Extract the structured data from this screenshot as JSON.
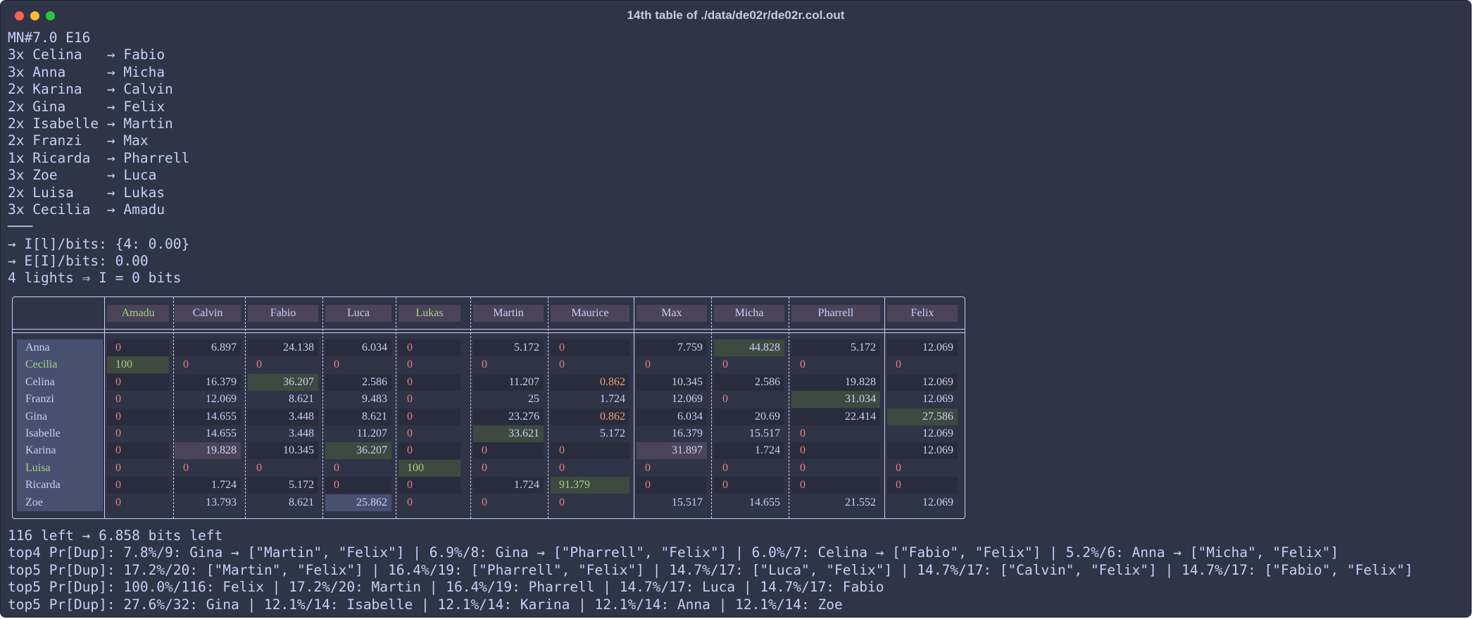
{
  "window": {
    "title": "14th table of ./data/de02r/de02r.col.out"
  },
  "header_lines": [
    "MN#7.0 E16",
    "3x Celina   → Fabio",
    "3x Anna     → Micha",
    "2x Karina   → Calvin",
    "2x Gina     → Felix",
    "2x Isabelle → Martin",
    "2x Franzi   → Max",
    "1x Ricarda  → Pharrell",
    "3x Zoe      → Luca",
    "2x Luisa    → Lukas",
    "3x Cecilia  → Amadu",
    "───",
    "→ I[l]/bits: {4: 0.00}",
    "→ E[I]/bits: 0.00",
    "4 lights ⇒ I = 0 bits"
  ],
  "table": {
    "columns": [
      "Amadu",
      "Calvin",
      "Fabio",
      "Luca",
      "Lukas",
      "Martin",
      "Maurice",
      "Max",
      "Micha",
      "Pharrell",
      "Felix"
    ],
    "rows": [
      {
        "name": "Anna",
        "cells": [
          "0",
          "6.897",
          "24.138",
          "6.034",
          "0",
          "5.172",
          "0",
          "7.759",
          "44.828",
          "5.172",
          "12.069"
        ]
      },
      {
        "name": "Cecilia",
        "cells": [
          "100",
          "0",
          "0",
          "0",
          "0",
          "0",
          "0",
          "0",
          "0",
          "0",
          "0"
        ]
      },
      {
        "name": "Celina",
        "cells": [
          "0",
          "16.379",
          "36.207",
          "2.586",
          "0",
          "11.207",
          "0.862",
          "10.345",
          "2.586",
          "19.828",
          "12.069"
        ]
      },
      {
        "name": "Franzi",
        "cells": [
          "0",
          "12.069",
          "8.621",
          "9.483",
          "0",
          "25",
          "1.724",
          "12.069",
          "0",
          "31.034",
          "12.069"
        ]
      },
      {
        "name": "Gina",
        "cells": [
          "0",
          "14.655",
          "3.448",
          "8.621",
          "0",
          "23.276",
          "0.862",
          "6.034",
          "20.69",
          "22.414",
          "27.586"
        ]
      },
      {
        "name": "Isabelle",
        "cells": [
          "0",
          "14.655",
          "3.448",
          "11.207",
          "0",
          "33.621",
          "5.172",
          "16.379",
          "15.517",
          "0",
          "12.069"
        ]
      },
      {
        "name": "Karina",
        "cells": [
          "0",
          "19.828",
          "10.345",
          "36.207",
          "0",
          "0",
          "0",
          "31.897",
          "1.724",
          "0",
          "12.069"
        ]
      },
      {
        "name": "Luisa",
        "cells": [
          "0",
          "0",
          "0",
          "0",
          "100",
          "0",
          "0",
          "0",
          "0",
          "0",
          "0"
        ]
      },
      {
        "name": "Ricarda",
        "cells": [
          "0",
          "1.724",
          "5.172",
          "0",
          "0",
          "1.724",
          "91.379",
          "0",
          "0",
          "0",
          "0"
        ]
      },
      {
        "name": "Zoe",
        "cells": [
          "0",
          "13.793",
          "8.621",
          "25.862",
          "0",
          "0",
          "0",
          "15.517",
          "14.655",
          "21.552",
          "12.069"
        ]
      }
    ]
  },
  "footer_lines": [
    "116 left → 6.858 bits left",
    "top4 Pr[Dup]: 7.8%/9: Gina → [\"Martin\", \"Felix\"] | 6.9%/8: Gina → [\"Pharrell\", \"Felix\"] | 6.0%/7: Celina → [\"Fabio\", \"Felix\"] | 5.2%/6: Anna → [\"Micha\", \"Felix\"]",
    "top5 Pr[Dup]: 17.2%/20: [\"Martin\", \"Felix\"] | 16.4%/19: [\"Pharrell\", \"Felix\"] | 14.7%/17: [\"Luca\", \"Felix\"] | 14.7%/17: [\"Calvin\", \"Felix\"] | 14.7%/17: [\"Fabio\", \"Felix\"]",
    "top5 Pr[Dup]: 100.0%/116: Felix | 17.2%/20: Martin | 16.4%/19: Pharrell | 14.7%/17: Luca | 14.7%/17: Fabio",
    "top5 Pr[Dup]: 27.6%/32: Gina | 12.1%/14: Isabelle | 12.1%/14: Karina | 12.1%/14: Anna | 12.1%/14: Zoe"
  ],
  "colors": {
    "background": "#303447",
    "text": "#c6d0f5",
    "zero": "#e78284",
    "green": "#a6d189",
    "highlight_green": "#3e4a3f",
    "highlight_purple": "#4b4459",
    "highlight_blue": "#485070"
  }
}
